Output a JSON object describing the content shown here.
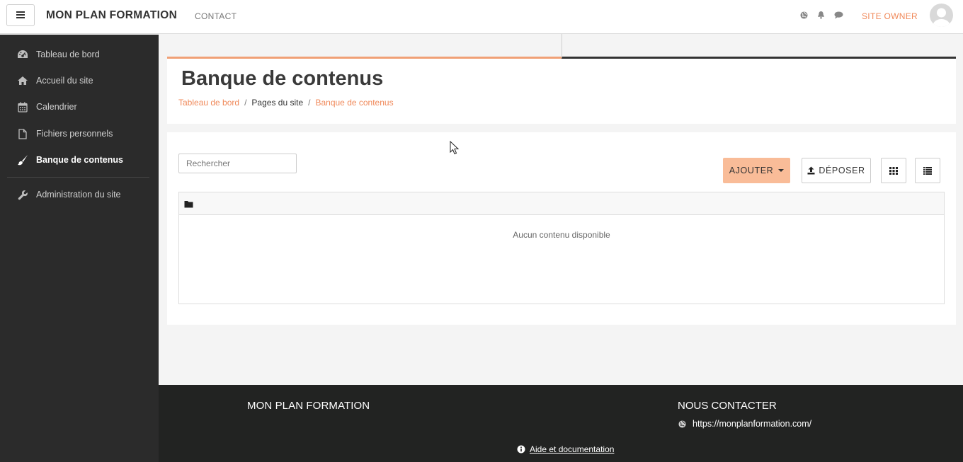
{
  "navbar": {
    "brand": "MON PLAN FORMATION",
    "contact_label": "CONTACT",
    "user_label": "SITE OWNER"
  },
  "sidebar": {
    "items": [
      {
        "label": "Tableau de bord",
        "icon": "dashboard-icon"
      },
      {
        "label": "Accueil du site",
        "icon": "home-icon"
      },
      {
        "label": "Calendrier",
        "icon": "calendar-icon"
      },
      {
        "label": "Fichiers personnels",
        "icon": "file-icon"
      },
      {
        "label": "Banque de contenus",
        "icon": "paintbrush-icon",
        "active": true
      },
      {
        "label": "Administration du site",
        "icon": "wrench-icon"
      }
    ]
  },
  "header": {
    "title": "Banque de contenus",
    "breadcrumb": [
      "Tableau de bord",
      "Pages du site",
      "Banque de contenus"
    ]
  },
  "content": {
    "search_placeholder": "Rechercher",
    "add_label": "AJOUTER",
    "upload_label": "DÉPOSER",
    "empty_message": "Aucun contenu disponible"
  },
  "footer": {
    "brand": "MON PLAN FORMATION",
    "contact_heading": "NOUS CONTACTER",
    "url": "https://monplanformation.com/",
    "help_label": "Aide et documentation"
  },
  "colors": {
    "accent": "#f0895a",
    "add_button": "#f9bc98",
    "sidebar_bg": "#2b2b2b",
    "footer_bg": "#222322"
  }
}
